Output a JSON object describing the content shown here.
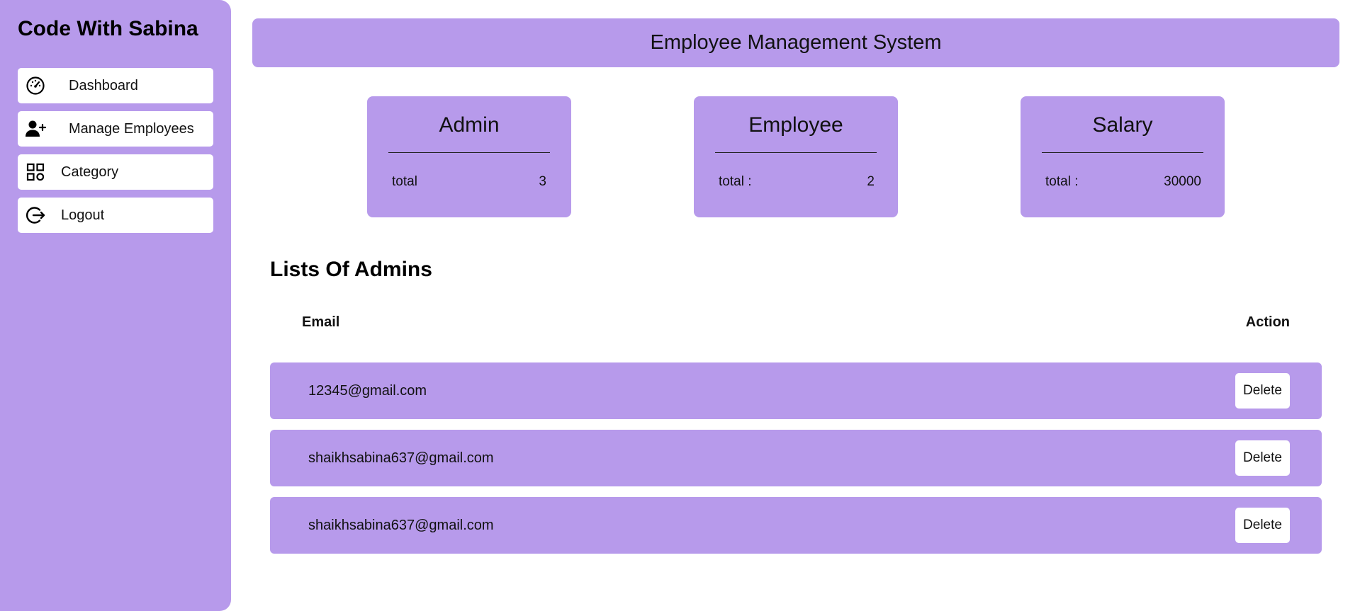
{
  "sidebar": {
    "brand": "Code With Sabina",
    "items": [
      {
        "label": "Dashboard",
        "icon": "speedometer-icon"
      },
      {
        "label": "Manage Employees",
        "icon": "person-add-icon"
      },
      {
        "label": "Category",
        "icon": "grid-icon"
      },
      {
        "label": "Logout",
        "icon": "logout-icon"
      }
    ]
  },
  "header": {
    "title": "Employee Management System"
  },
  "stats": [
    {
      "title": "Admin",
      "label": "total",
      "value": "3"
    },
    {
      "title": "Employee",
      "label": "total :",
      "value": "2"
    },
    {
      "title": "Salary",
      "label": "total :",
      "value": "30000"
    }
  ],
  "admins": {
    "title": "Lists Of Admins",
    "columns": {
      "email": "Email",
      "action": "Action"
    },
    "rows": [
      {
        "email": "12345@gmail.com",
        "action_label": "Delete"
      },
      {
        "email": "shaikhsabina637@gmail.com",
        "action_label": "Delete"
      },
      {
        "email": "shaikhsabina637@gmail.com",
        "action_label": "Delete"
      }
    ]
  },
  "colors": {
    "accent": "#b79aeb",
    "surface": "#ffffff",
    "text": "#111111"
  }
}
